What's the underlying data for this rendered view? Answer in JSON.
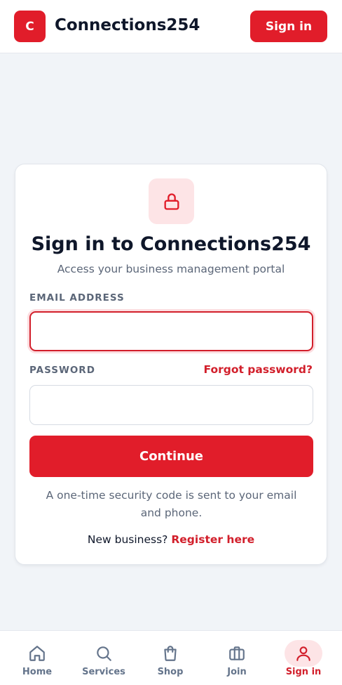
{
  "header": {
    "logo_letter": "C",
    "brand": "Connections254",
    "signin_label": "Sign in"
  },
  "card": {
    "lock_icon": "lock-icon",
    "title": "Sign in to Connections254",
    "subtitle": "Access your business management portal",
    "email_label": "EMAIL ADDRESS",
    "email_value": "",
    "password_label": "PASSWORD",
    "password_value": "",
    "forgot_label": "Forgot password?",
    "continue_label": "Continue",
    "otp_note": "A one-time security code is sent to your email and phone.",
    "register_prompt": "New business?",
    "register_link": "Register here"
  },
  "nav": {
    "items": [
      {
        "label": "Home",
        "icon": "home-icon",
        "active": false
      },
      {
        "label": "Services",
        "icon": "search-icon",
        "active": false
      },
      {
        "label": "Shop",
        "icon": "shopping-bag-icon",
        "active": false
      },
      {
        "label": "Join",
        "icon": "briefcase-icon",
        "active": false
      },
      {
        "label": "Sign in",
        "icon": "user-icon",
        "active": true
      }
    ]
  },
  "colors": {
    "accent": "#e11d2a",
    "accent_soft": "#fde4e6",
    "text_muted": "#5b6678",
    "background": "#f1f4f8"
  }
}
